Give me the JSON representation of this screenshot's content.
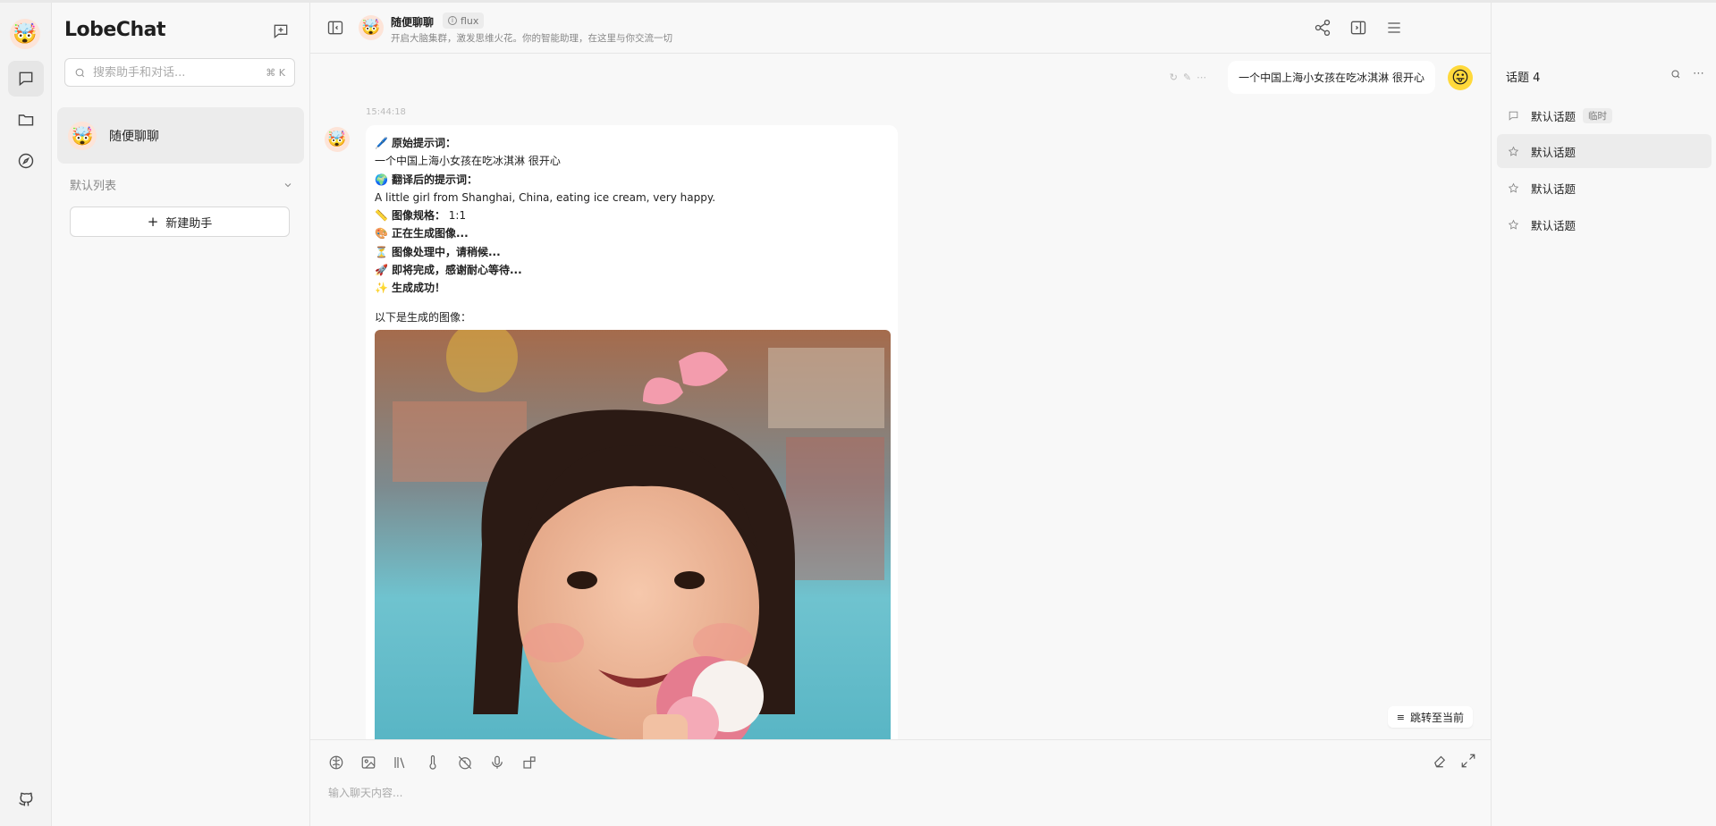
{
  "app": {
    "name": "LobeChat"
  },
  "sessions": {
    "search_placeholder": "搜索助手和对话...",
    "search_shortcut": "⌘ K",
    "items": [
      {
        "name": "随便聊聊"
      }
    ],
    "group_label": "默认列表",
    "new_assistant": "新建助手"
  },
  "header": {
    "title": "随便聊聊",
    "model": "flux",
    "description": "开启大脑集群，激发思维火花。你的智能助理，在这里与你交流一切"
  },
  "chat": {
    "user_message": "一个中国上海小女孩在吃冰淇淋 很开心",
    "timestamp": "15:44:18",
    "bot": {
      "lines": [
        {
          "emoji": "🖊️",
          "label": "原始提示词：",
          "bold": true
        },
        {
          "emoji": "",
          "label": "一个中国上海小女孩在吃冰淇淋 很开心",
          "bold": false
        },
        {
          "emoji": "🌍",
          "label": "翻译后的提示词：",
          "bold": true
        },
        {
          "emoji": "",
          "label": "A little girl from Shanghai, China, eating ice cream, very happy.",
          "bold": false
        },
        {
          "emoji": "📏",
          "label": "图像规格：",
          "bold": true,
          "suffix": " 1:1"
        },
        {
          "emoji": "🎨",
          "label": "正在生成图像...",
          "bold": true
        },
        {
          "emoji": "⏳",
          "label": "图像处理中，请稍候...",
          "bold": true
        },
        {
          "emoji": "🚀",
          "label": "即将完成，感谢耐心等待...",
          "bold": true
        },
        {
          "emoji": "✨",
          "label": "生成成功！",
          "bold": true
        }
      ],
      "image_caption": "以下是生成的图像："
    },
    "jump_label": "跳转至当前"
  },
  "input": {
    "placeholder": "输入聊天内容..."
  },
  "topics": {
    "title": "话题 4",
    "items": [
      {
        "label": "默认话题",
        "tag": "临时",
        "icon": "message-icon"
      },
      {
        "label": "默认话题",
        "tag": "",
        "icon": "star-icon"
      },
      {
        "label": "默认话题",
        "tag": "",
        "icon": "star-icon"
      },
      {
        "label": "默认话题",
        "tag": "",
        "icon": "star-icon"
      }
    ]
  }
}
